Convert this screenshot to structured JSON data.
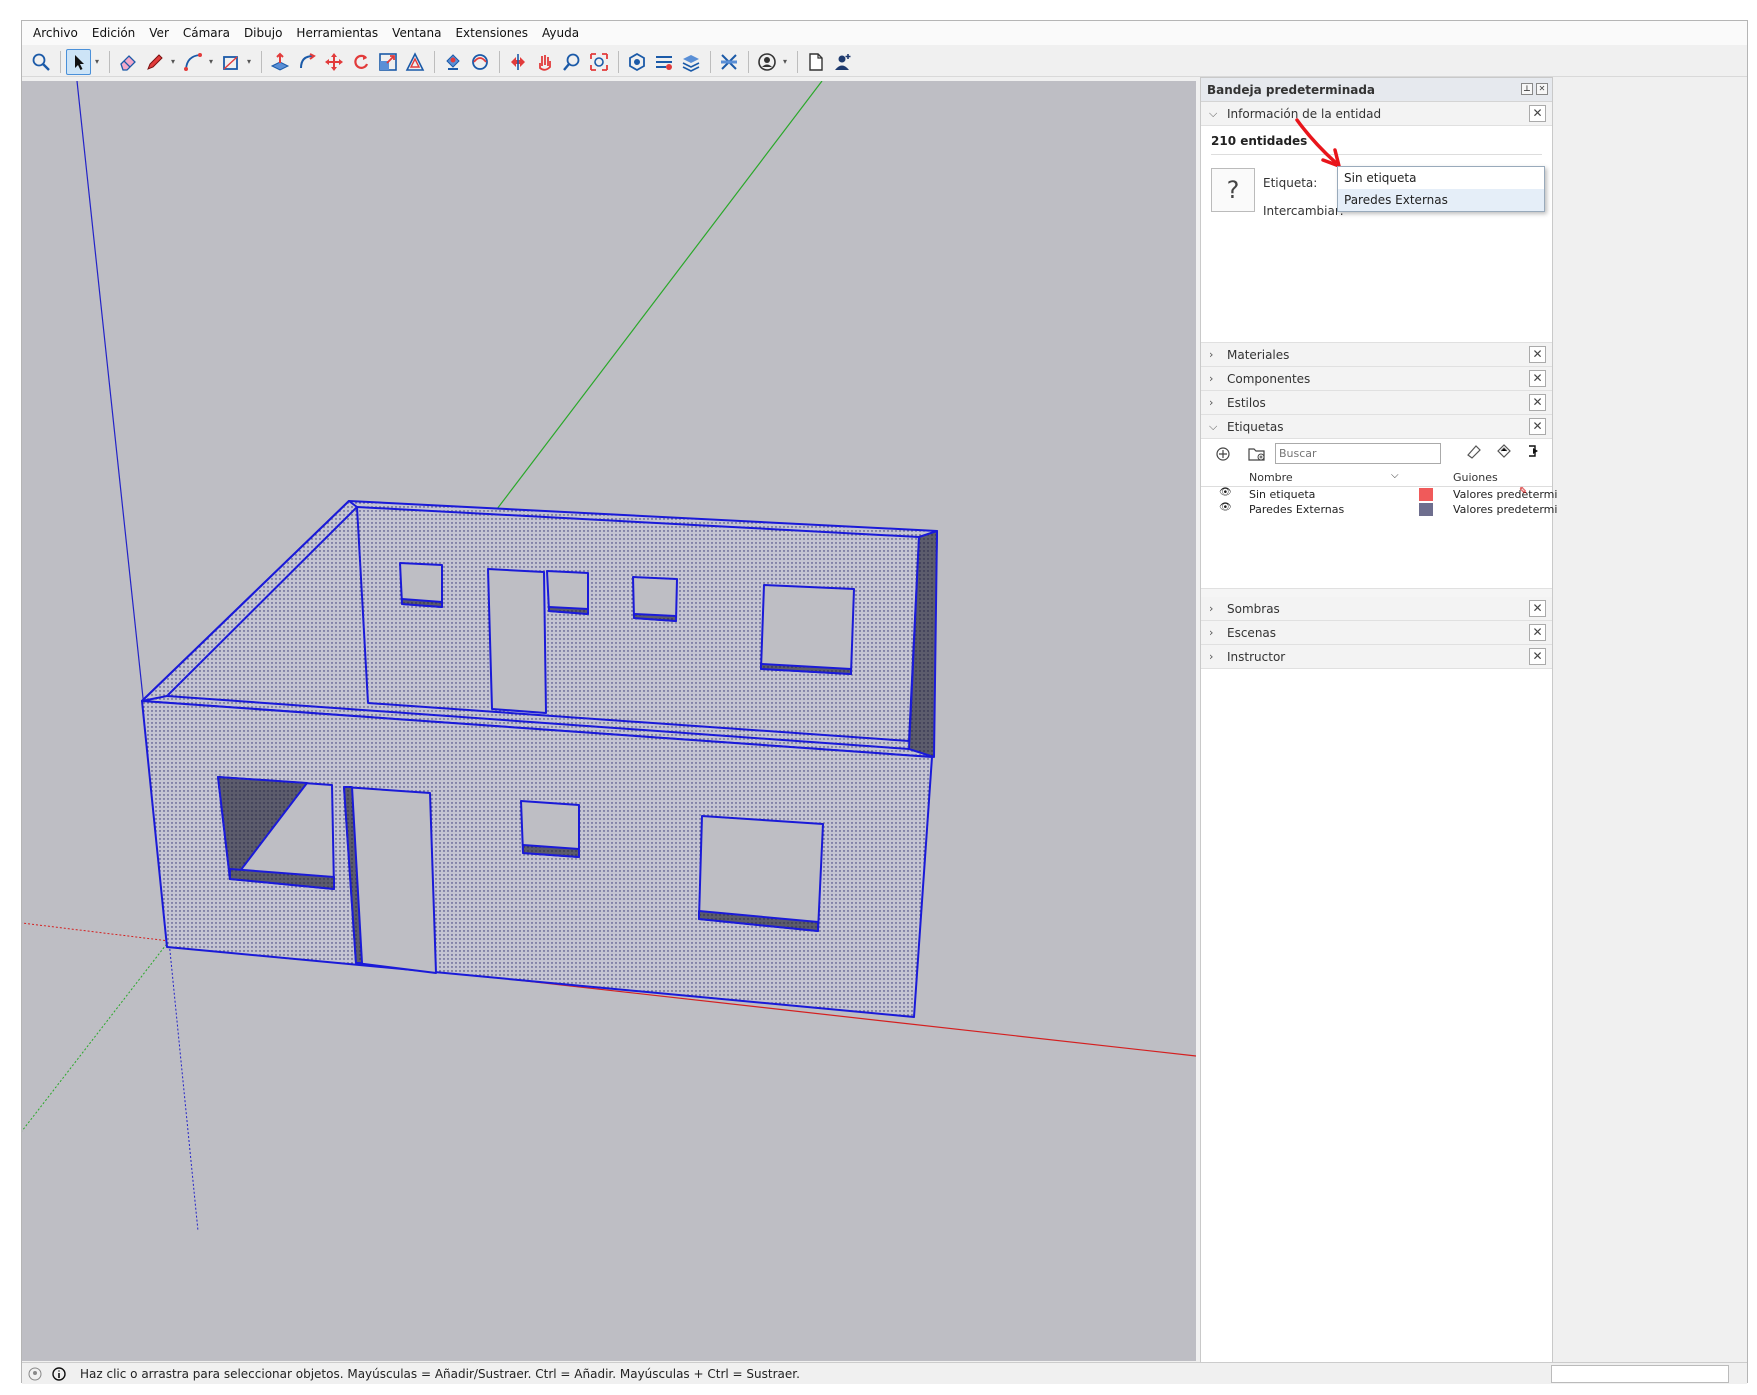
{
  "menu": [
    "Archivo",
    "Edición",
    "Ver",
    "Cámara",
    "Dibujo",
    "Herramientas",
    "Ventana",
    "Extensiones",
    "Ayuda"
  ],
  "toolbar": {
    "tools": [
      "zoom-extents-icon",
      "select-icon",
      "eraser-icon",
      "pencil-icon",
      "arc-icon",
      "rectangle-icon",
      "push-pull-icon",
      "follow-me-icon",
      "move-icon",
      "rotate-icon",
      "scale-icon",
      "offset-icon",
      "paint-bucket-icon",
      "orbit-icon",
      "pan-icon",
      "walk-icon",
      "zoom-icon",
      "zoom-window-icon",
      "warehouse-icon",
      "extension-icon",
      "layer-icon",
      "section-icon",
      "user-icon",
      "new-page-icon",
      "account-icon"
    ]
  },
  "tray": {
    "title": "Bandeja predeterminada",
    "entity_panel": {
      "title": "Información de la entidad",
      "count": "210 entidades",
      "icon_glyph": "?",
      "tag_label": "Etiqueta:",
      "swap_label": "Intercambiar:",
      "options": [
        "Sin etiqueta",
        "Paredes Externas"
      ]
    },
    "panels_top": [
      "Materiales",
      "Componentes",
      "Estilos",
      "Etiquetas"
    ],
    "tags": {
      "search_placeholder": "Buscar",
      "col_name": "Nombre",
      "col_dash": "Guiones",
      "rows": [
        {
          "name": "Sin etiqueta",
          "color": "#f05a5a",
          "dash": "Valores predetermi"
        },
        {
          "name": "Paredes Externas",
          "color": "#6e6e8e",
          "dash": "Valores predetermi"
        }
      ]
    },
    "panels_bottom": [
      "Sombras",
      "Escenas",
      "Instructor"
    ]
  },
  "status": {
    "text": "Haz clic o arrastra para seleccionar objetos. Mayúsculas = Añadir/Sustraer. Ctrl = Añadir. Mayúsculas + Ctrl = Sustraer."
  },
  "colors": {
    "viewport": "#bebec4",
    "wall_face": "#c4c4d2",
    "wall_inner": "#5c5c6c",
    "selection": "#1a1ad8",
    "annotation_arrow": "#e8151b"
  }
}
